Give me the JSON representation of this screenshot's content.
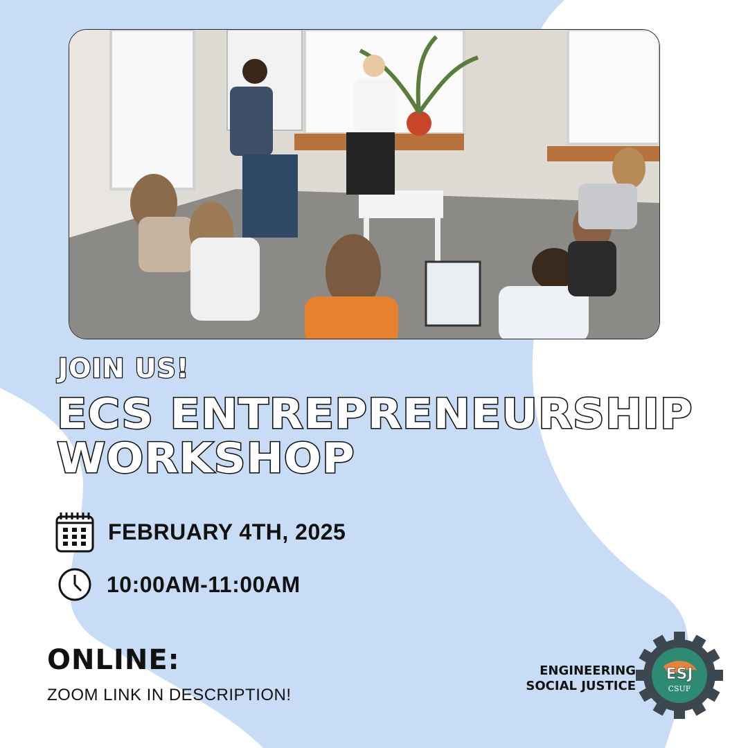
{
  "colors": {
    "blob": "#c9dcf5",
    "text": "#111111",
    "logo_gear": "#3d4750",
    "logo_inner": "#2f8a73",
    "logo_accent": "#e9813a"
  },
  "photo": {
    "alt": "Group of people seated in a circle at a workshop"
  },
  "header": {
    "kicker": "JOIN US!",
    "title_line1": "ECS ENTREPRENEURSHIP",
    "title_line2": "WORKSHOP"
  },
  "details": {
    "date": "FEBRUARY 4TH, 2025",
    "date_icon": "calendar-icon",
    "time": "10:00AM-11:00AM",
    "time_icon": "clock-icon"
  },
  "location": {
    "heading": "ONLINE:",
    "note": "ZOOM LINK IN DESCRIPTION!"
  },
  "organization": {
    "line1": "ENGINEERING",
    "line2": "SOCIAL JUSTICE",
    "logo_text": "ESJ",
    "logo_subtext": "CSUF"
  }
}
